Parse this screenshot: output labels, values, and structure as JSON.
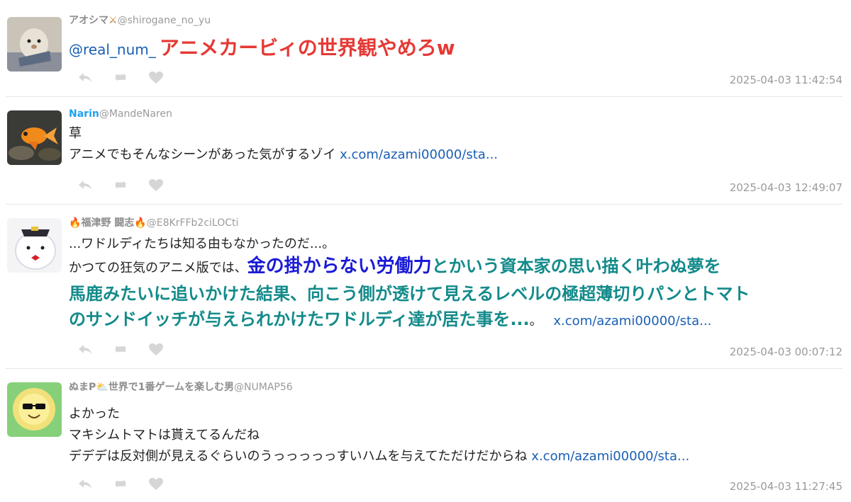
{
  "icons": {
    "reply": "reply-icon",
    "retweet": "retweet-icon",
    "like": "heart-icon",
    "fire": "fire-icon",
    "swords": "crossed-swords-icon",
    "sun_cloud": "sun-behind-cloud-icon"
  },
  "colors": {
    "mention_link": "#1a5fb4",
    "red_text": "#e53935",
    "blue_text": "#1a1ad6",
    "teal_text": "#138a8a",
    "name_blue": "#1da1f2",
    "meta_gray": "#9a9a9a"
  },
  "tweets": [
    {
      "name": "アオシマ",
      "name_suffix": "⚔",
      "handle": "@shirogane_no_yu",
      "mention": "@real_num_",
      "text_big": "アニメカービィの世界観やめろw",
      "time": "2025-04-03 11:42:54"
    },
    {
      "name": "Narin",
      "handle": "@MandeNaren",
      "line1": "草",
      "line2": "アニメでもそんなシーンがあった気がするゾイ",
      "link": "x.com/azami00000/sta...",
      "time": "2025-04-03 12:49:07"
    },
    {
      "name": "福津野 闘志",
      "name_prefix": "🔥",
      "name_suffix": "🔥",
      "handle": "@E8KrFFb2ciLOCti",
      "line1": "...ワドルディたちは知る由もなかったのだ...。",
      "line2_prefix": "かつての狂気のアニメ版では、",
      "line2_blue": "金の掛からない労働力",
      "line2_teal": "とかいう資本家の思い描く叶わぬ夢を",
      "line3": "馬鹿みたいに追いかけた結果、向こう側が透けて見えるレベルの極超薄切りパンとトマト",
      "line4": "のサンドイッチが与えられかけたワドルディ達が居た事を...",
      "line4_end": "。",
      "link": "x.com/azami00000/sta...",
      "time": "2025-04-03 00:07:12"
    },
    {
      "name_a": "ぬまP",
      "name_emoji": "⛅",
      "name_b": "世界で1番ゲームを楽しむ男",
      "handle": "@NUMAP56",
      "line1": "よかった",
      "line2": "マキシムトマトは貰えてるんだね",
      "line3": "デデデは反対側が見えるぐらいのうっっっっっすいハムを与えてただけだからね",
      "link": "x.com/azami00000/sta...",
      "time": "2025-04-03 11:27:45"
    }
  ]
}
